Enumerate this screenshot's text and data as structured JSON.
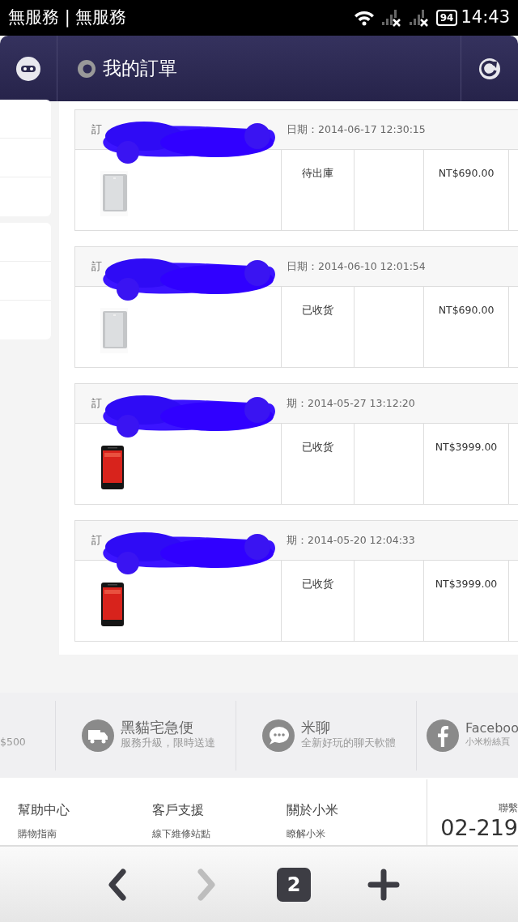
{
  "status_bar": {
    "carrier": "無服務 | 無服務",
    "battery": "94",
    "time": "14:43"
  },
  "header": {
    "title": "我的訂單"
  },
  "orders": [
    {
      "prefix": "訂",
      "date": "日期：2014-06-17 12:30:15",
      "kind": "power_bank",
      "redacted": true,
      "status": "待出庫",
      "price": "NT$690.00"
    },
    {
      "prefix": "訂",
      "date": "日期：2014-06-10 12:01:54",
      "kind": "power_bank",
      "redacted": true,
      "status": "已收货",
      "price": "NT$690.00"
    },
    {
      "prefix": "訂",
      "date": "期：2014-05-27 13:12:20",
      "kind": "phone",
      "redacted": true,
      "status": "已收货",
      "price": "NT$3999.00"
    },
    {
      "prefix": "訂",
      "date": "期：2014-05-20 12:04:33",
      "kind": "phone",
      "redacted": true,
      "status": "已收货",
      "price": "NT$3999.00"
    }
  ],
  "services": [
    {
      "kind": "partial",
      "subtitle": "$500"
    },
    {
      "kind": "truck",
      "title": "黑貓宅急便",
      "subtitle": "服務升級，限時送達"
    },
    {
      "kind": "chat",
      "title": "米聊",
      "subtitle": "全新好玩的聊天軟體"
    },
    {
      "kind": "facebook",
      "title": "Faceboo",
      "subtitle": "小米粉絲頁"
    }
  ],
  "footer_links": [
    {
      "title": "幫助中心",
      "link": "購物指南"
    },
    {
      "title": "客戶支援",
      "link": "線下維修站點"
    },
    {
      "title": "關於小米",
      "link": "瞭解小米"
    }
  ],
  "contact": {
    "label": "聯繫",
    "phone": "02-219"
  },
  "bottom_bar": {
    "back": {
      "disabled": false
    },
    "forward": {
      "disabled": true
    },
    "tab_count": "2"
  }
}
